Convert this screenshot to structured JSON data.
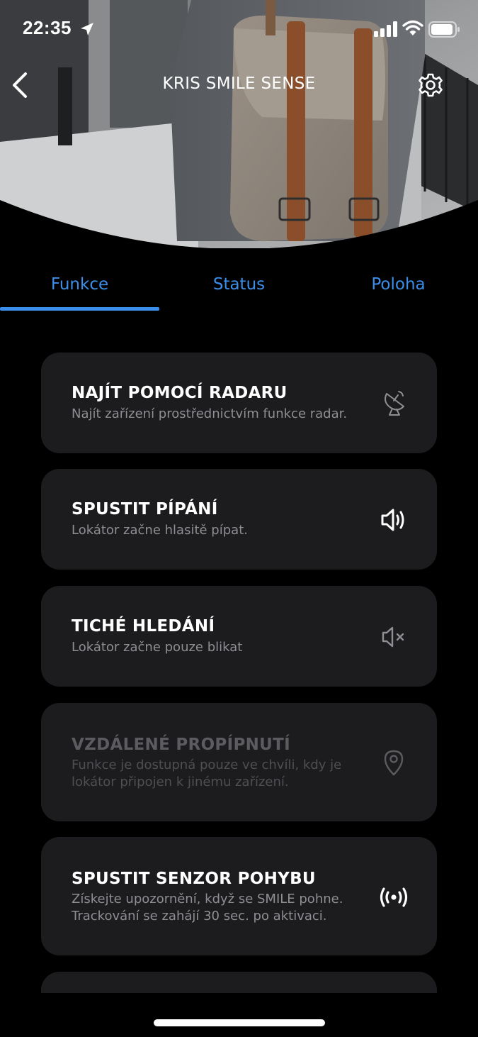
{
  "status_bar": {
    "time": "22:35"
  },
  "header": {
    "title": "KRIS SMILE SENSE",
    "back_icon": "chevron-left-icon",
    "settings_icon": "gear-icon"
  },
  "tabs": [
    {
      "label": "Funkce",
      "selected": true
    },
    {
      "label": "Status",
      "selected": false
    },
    {
      "label": "Poloha",
      "selected": false
    }
  ],
  "colors": {
    "accent": "#3b8eea",
    "card_bg": "#1c1c1e",
    "subtitle": "#8e8e93"
  },
  "functions": [
    {
      "title": "NAJÍT POMOCÍ RADARU",
      "subtitle": "Najít zařízení prostřednictvím funkce radar.",
      "icon": "radar-dish-icon",
      "enabled": true
    },
    {
      "title": "SPUSTIT PÍPÁNÍ",
      "subtitle": "Lokátor začne hlasitě pípat.",
      "icon": "speaker-loud-icon",
      "enabled": true
    },
    {
      "title": "TICHÉ HLEDÁNÍ",
      "subtitle": "Lokátor začne pouze blikat",
      "icon": "speaker-muted-icon",
      "enabled": true
    },
    {
      "title": "VZDÁLENÉ PROPÍPNUTÍ",
      "subtitle_lines": [
        "Funkce je dostupná pouze ve chvíli, kdy je",
        "lokátor připojen k jinému zařízení."
      ],
      "icon": "location-pin-icon",
      "enabled": false
    },
    {
      "title": "SPUSTIT SENZOR POHYBU",
      "subtitle_lines": [
        "Získejte upozornění, když se SMILE pohne.",
        "Trackování se zahájí 30 sec. po aktivaci."
      ],
      "icon": "broadcast-icon",
      "enabled": true
    }
  ]
}
